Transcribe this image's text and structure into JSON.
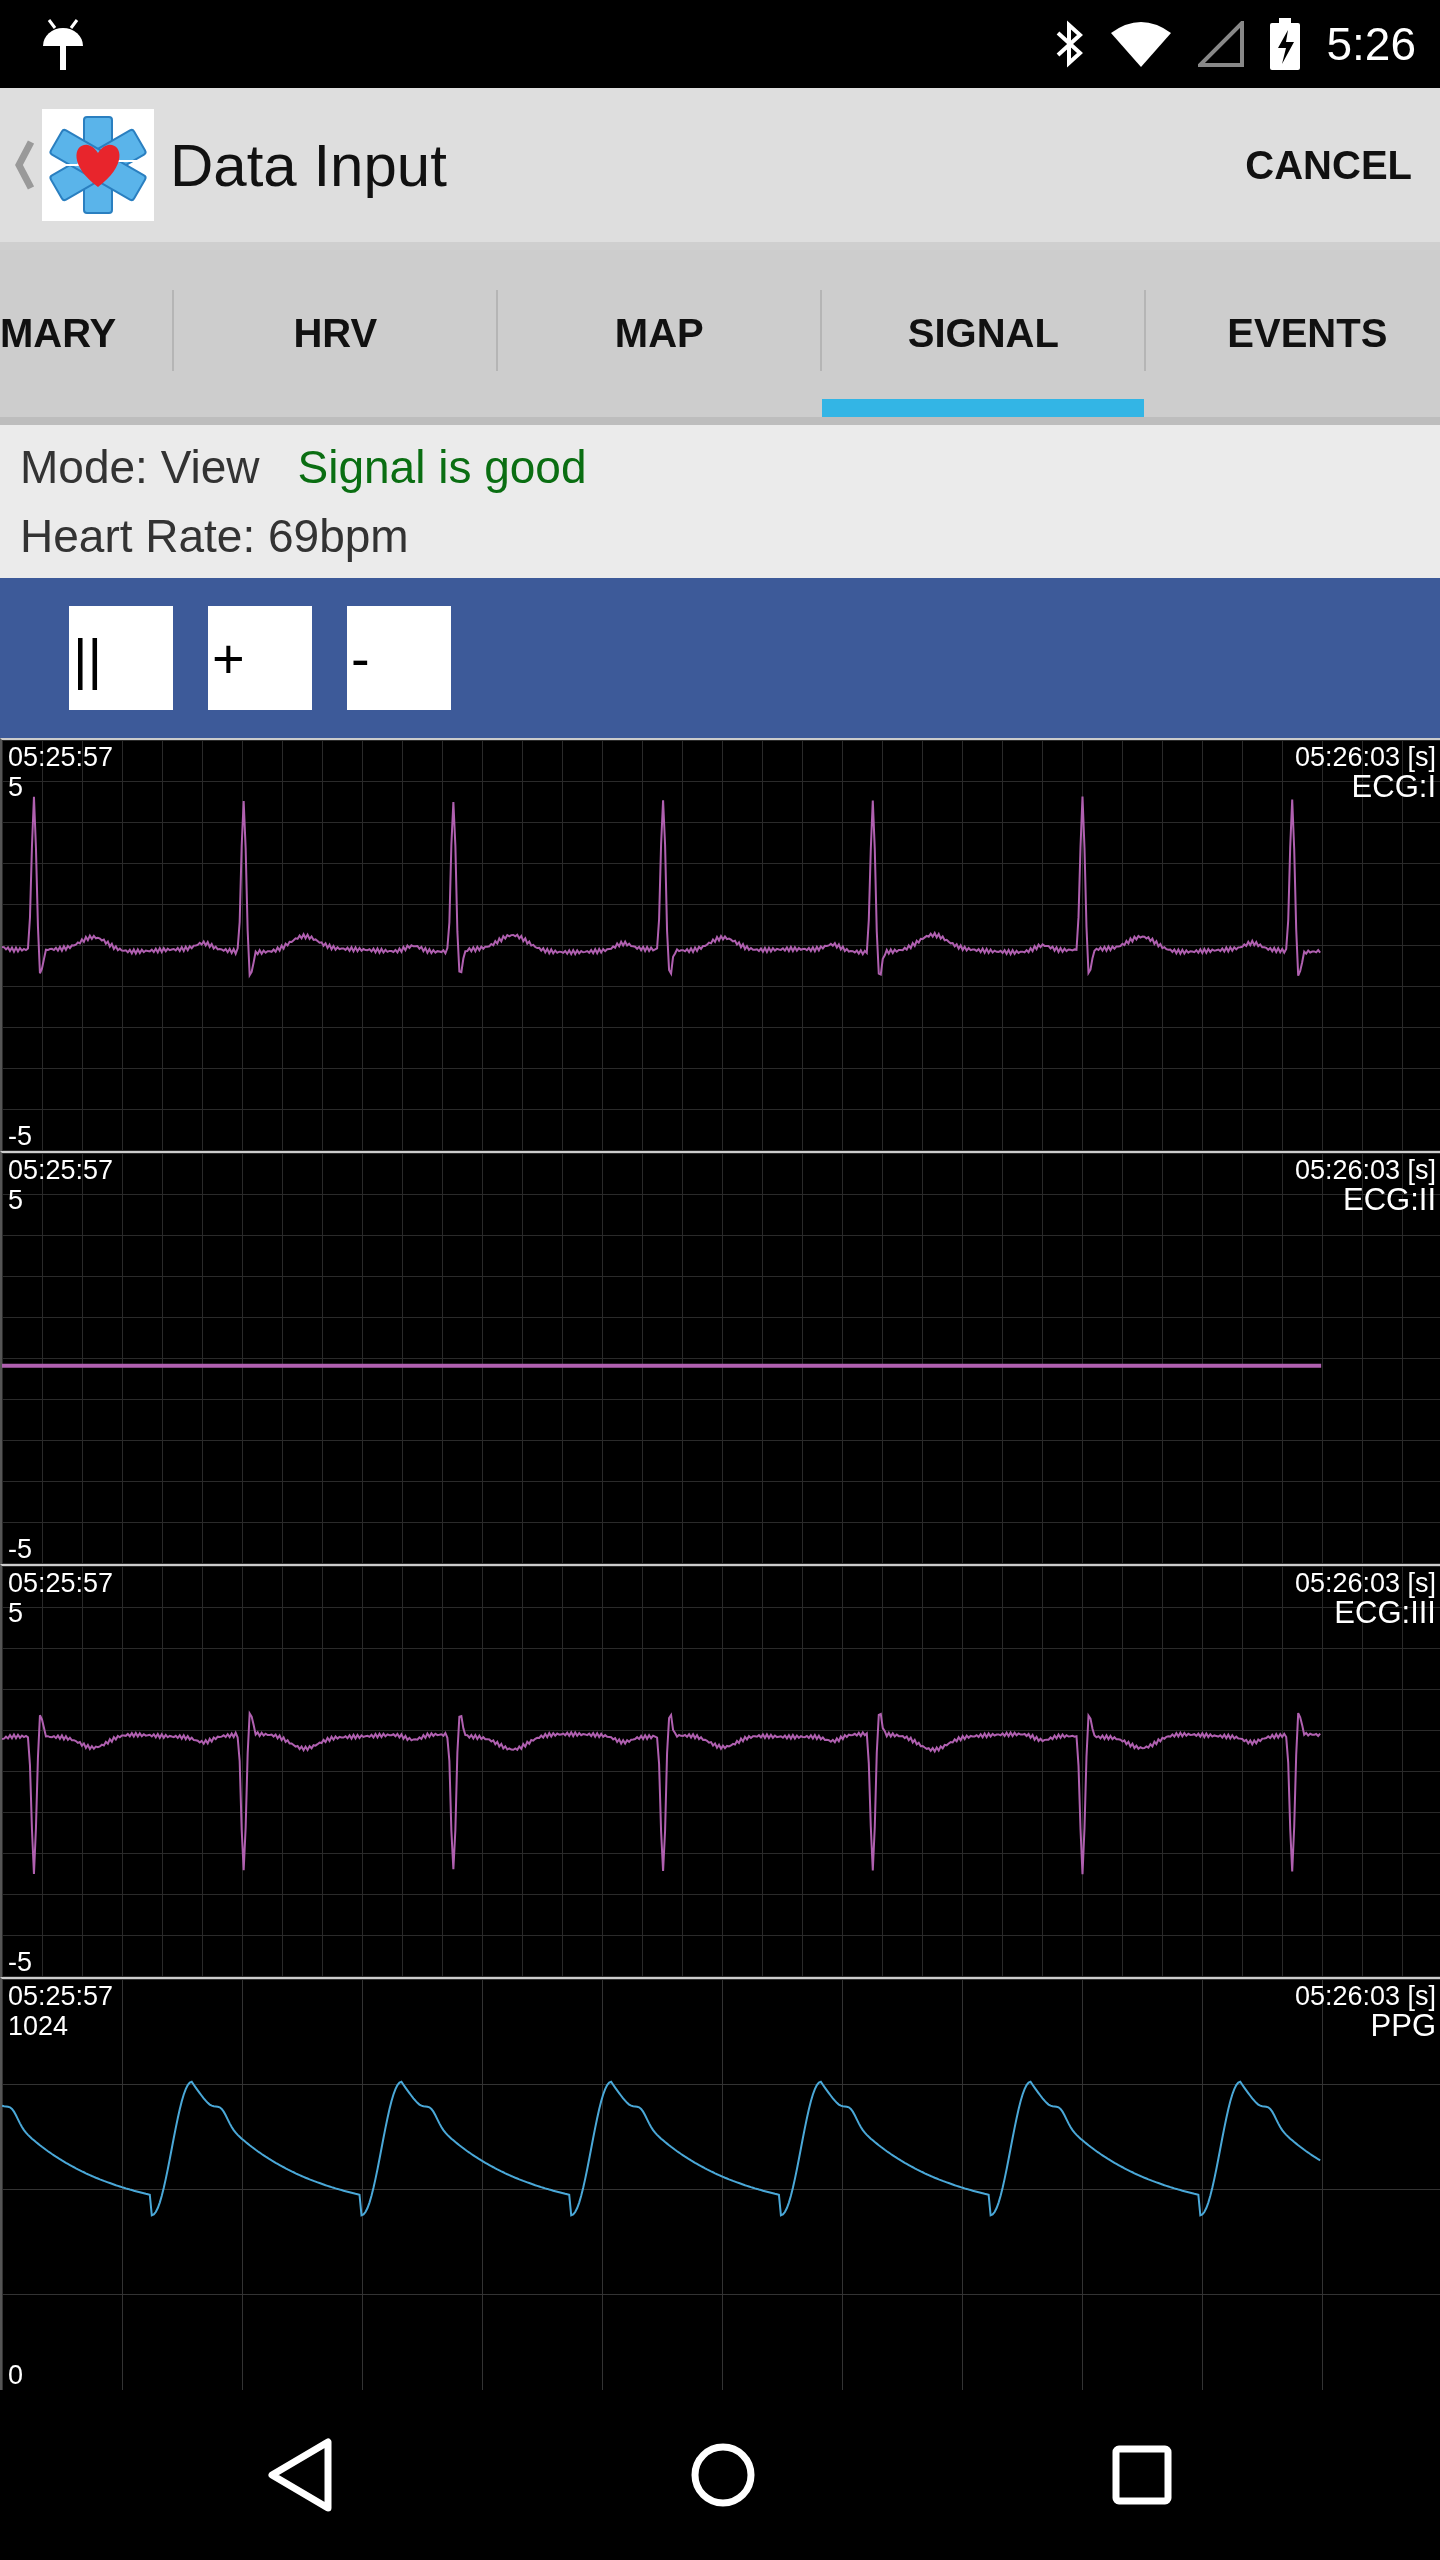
{
  "status_bar": {
    "time": "5:26"
  },
  "app_bar": {
    "title": "Data Input",
    "action": "CANCEL"
  },
  "tabs": [
    {
      "label": "MARY",
      "selected": false
    },
    {
      "label": "HRV",
      "selected": false
    },
    {
      "label": "MAP",
      "selected": false
    },
    {
      "label": "SIGNAL",
      "selected": true
    },
    {
      "label": "EVENTS",
      "selected": false
    }
  ],
  "info": {
    "mode": "Mode: View",
    "signal_status": "Signal is good",
    "heart_rate": "Heart Rate: 69bpm"
  },
  "toolbar": {
    "buttons": [
      "||",
      "+",
      "-"
    ]
  },
  "charts": [
    {
      "start_time": "05:25:57",
      "end_time": "05:26:03 [s]",
      "y_max": "5",
      "y_min": "-5",
      "label": "ECG:I",
      "kind": "ecg",
      "color": "#b060b0"
    },
    {
      "start_time": "05:25:57",
      "end_time": "05:26:03 [s]",
      "y_max": "5",
      "y_min": "-5",
      "label": "ECG:II",
      "kind": "flat",
      "color": "#b060b0"
    },
    {
      "start_time": "05:25:57",
      "end_time": "05:26:03 [s]",
      "y_max": "5",
      "y_min": "-5",
      "label": "ECG:III",
      "kind": "ecg_inverted",
      "color": "#b060b0"
    },
    {
      "start_time": "05:25:57",
      "end_time": "05:26:03 [s]",
      "y_max": "1024",
      "y_min": "0",
      "label": "PPG",
      "kind": "ppg",
      "color": "#4aa8d8"
    }
  ]
}
